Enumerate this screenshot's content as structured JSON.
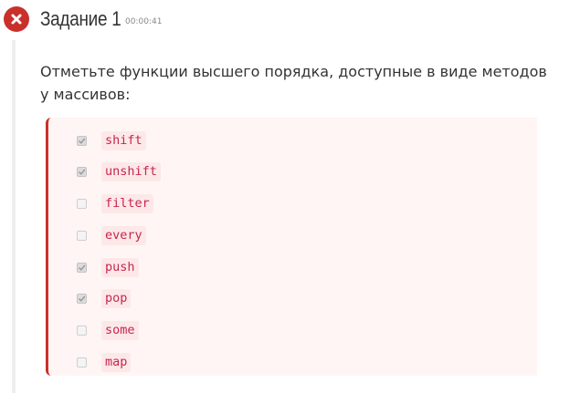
{
  "task": {
    "title": "Задание 1",
    "timer": "00:00:41",
    "status_icon": "error-x-circle",
    "status_color": "#c9302c"
  },
  "question": {
    "text": "Отметьте функции высшего порядка, доступные в виде методов у массивов:"
  },
  "options": [
    {
      "label": "shift",
      "checked": true
    },
    {
      "label": "unshift",
      "checked": true
    },
    {
      "label": "filter",
      "checked": false
    },
    {
      "label": "every",
      "checked": false
    },
    {
      "label": "push",
      "checked": true
    },
    {
      "label": "pop",
      "checked": true
    },
    {
      "label": "some",
      "checked": false
    },
    {
      "label": "map",
      "checked": false
    }
  ]
}
